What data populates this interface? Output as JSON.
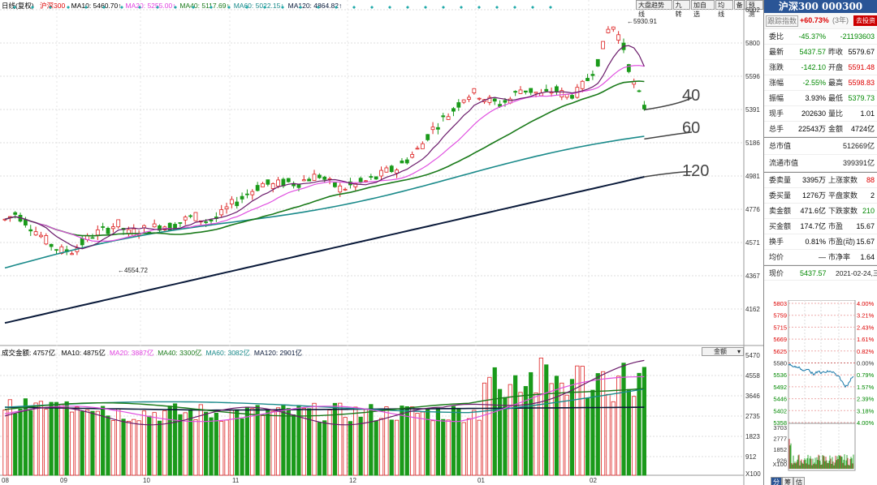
{
  "header": {
    "period": "日线(复权)",
    "name": "沪深300",
    "ma": [
      {
        "label": "MA10: 5460.70",
        "color": "#000000",
        "arrow": "↑"
      },
      {
        "label": "MA20: 5255.00",
        "color": "#e040e0",
        "arrow": "↑"
      },
      {
        "label": "MA40: 5117.69",
        "color": "#1a7a1a",
        "arrow": "↑"
      },
      {
        "label": "MA60: 5022.15",
        "color": "#1a8a8a",
        "arrow": "↑"
      },
      {
        "label": "MA120: 4864.82",
        "color": "#0a1a3a",
        "arrow": "↑"
      }
    ]
  },
  "toolbar": [
    "大盘趋势线",
    "九转",
    "加自选",
    "均线",
    "备",
    "预测"
  ],
  "price_axis": [
    "6002",
    "5800",
    "5596",
    "5391",
    "5186",
    "4981",
    "4776",
    "4571",
    "4367",
    "4162"
  ],
  "vol_axis": [
    "5470",
    "4558",
    "3646",
    "2735",
    "1823",
    "912",
    "X100"
  ],
  "annotations": {
    "high": "5930.91",
    "low": "4554.72",
    "ma40": "40",
    "ma60": "60",
    "ma120": "120"
  },
  "volume_header": {
    "title": "成交金额: 4757亿",
    "ma": [
      {
        "label": "MA10: 4875亿",
        "color": "#000000"
      },
      {
        "label": "MA20: 3887亿",
        "color": "#e040e0"
      },
      {
        "label": "MA40: 3300亿",
        "color": "#1a7a1a"
      },
      {
        "label": "MA60: 3082亿",
        "color": "#1a8a8a"
      },
      {
        "label": "MA120: 2901亿",
        "color": "#0a1a3a"
      }
    ],
    "dropdown": "金额"
  },
  "x_labels": [
    "08",
    "09",
    "10",
    "11",
    "12",
    "01",
    "02"
  ],
  "side": {
    "title": "沪深300 000300",
    "tracking": "跟踪指数",
    "tracking_val": "+60.73%",
    "tracking_note": "(3年)",
    "invest_btn": "去投资",
    "rows": [
      {
        "a": "委比",
        "b": "-45.37%",
        "c": "",
        "d": "-21193603",
        "bc": "green",
        "dc": "green"
      },
      {
        "a": "最新",
        "b": "5437.57",
        "c": "昨收",
        "d": "5579.67",
        "bc": "green",
        "dc": "blk"
      },
      {
        "a": "涨跌",
        "b": "-142.10",
        "c": "开盘",
        "d": "5591.48",
        "bc": "green",
        "dc": "red"
      },
      {
        "a": "涨幅",
        "b": "-2.55%",
        "c": "最高",
        "d": "5598.83",
        "bc": "green",
        "dc": "red"
      },
      {
        "a": "振幅",
        "b": "3.93%",
        "c": "最低",
        "d": "5379.73",
        "bc": "blk",
        "dc": "green"
      },
      {
        "a": "现手",
        "b": "202630",
        "c": "量比",
        "d": "1.01",
        "bc": "blk",
        "dc": "blk"
      },
      {
        "a": "总手",
        "b": "22543万",
        "c": "金额",
        "d": "4724亿",
        "bc": "blk",
        "dc": "blk"
      }
    ],
    "mkt": [
      {
        "a": "总市值",
        "d": "512669亿"
      },
      {
        "a": "流通市值",
        "d": "399391亿"
      }
    ],
    "rows2": [
      {
        "a": "委卖量",
        "b": "3395万",
        "c": "上涨家数",
        "d": "88",
        "bc": "blk",
        "dc": "red"
      },
      {
        "a": "委买量",
        "b": "1276万",
        "c": "平盘家数",
        "d": "2",
        "bc": "blk",
        "dc": "blk"
      },
      {
        "a": "卖金额",
        "b": "471.6亿",
        "c": "下跌家数",
        "d": "210",
        "bc": "blk",
        "dc": "green"
      },
      {
        "a": "买金额",
        "b": "174.7亿",
        "c": "市盈",
        "d": "15.67",
        "bc": "blk",
        "dc": "blk"
      },
      {
        "a": "换手",
        "b": "0.81%",
        "c": "市盈(动)",
        "d": "15.67",
        "bc": "blk",
        "dc": "blk"
      },
      {
        "a": "均价",
        "b": "—",
        "c": "市净率",
        "d": "1.64",
        "bc": "blk",
        "dc": "blk"
      }
    ],
    "now_label": "现价",
    "now_price": "5437.57",
    "date": "2021-02-24,三",
    "mini_left": [
      "5803",
      "5759",
      "5715",
      "5669",
      "5625",
      "5580",
      "5536",
      "5492",
      "5446",
      "5402",
      "5358",
      "3703",
      "2777",
      "1852",
      "926",
      "X100"
    ],
    "mini_right": [
      "4.00%",
      "3.21%",
      "2.43%",
      "1.61%",
      "0.82%",
      "0.00%",
      "0.79%",
      "1.57%",
      "2.39%",
      "3.18%",
      "4.00%"
    ],
    "bottom_tabs": [
      "分",
      "筹",
      "估"
    ]
  }
}
